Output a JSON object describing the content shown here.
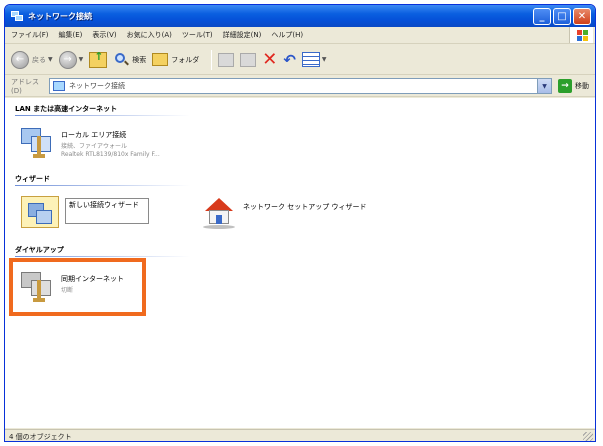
{
  "window": {
    "title": "ネットワーク接続",
    "buttons": {
      "minimize": "_",
      "maximize": "□",
      "close": "✕"
    }
  },
  "menu": [
    "ファイル(F)",
    "編集(E)",
    "表示(V)",
    "お気に入り(A)",
    "ツール(T)",
    "詳細設定(N)",
    "ヘルプ(H)"
  ],
  "toolbar": {
    "back_label": "戻る",
    "search_label": "検索",
    "folders_label": "フォルダ"
  },
  "address": {
    "label": "アドレス(D)",
    "value": "ネットワーク接続",
    "go_label": "移動"
  },
  "groups": [
    {
      "header": "LAN または高速インターネット",
      "items": [
        {
          "name": "ローカル エリア接続",
          "sub1": "接続、ファイアウォール",
          "sub2": "Realtek RTL8139/810x Family F..."
        }
      ]
    },
    {
      "header": "ウィザード",
      "items": [
        {
          "name": "新しい接続ウィザード"
        },
        {
          "name": "ネットワーク セットアップ ウィザード"
        }
      ]
    },
    {
      "header": "ダイヤルアップ",
      "items": [
        {
          "name": "同期インターネット",
          "sub1": "切断"
        }
      ]
    }
  ],
  "status": {
    "text": "4 個のオブジェクト"
  },
  "colors": {
    "title_blue": "#0a5fe0",
    "highlight": "#f06a1e"
  }
}
